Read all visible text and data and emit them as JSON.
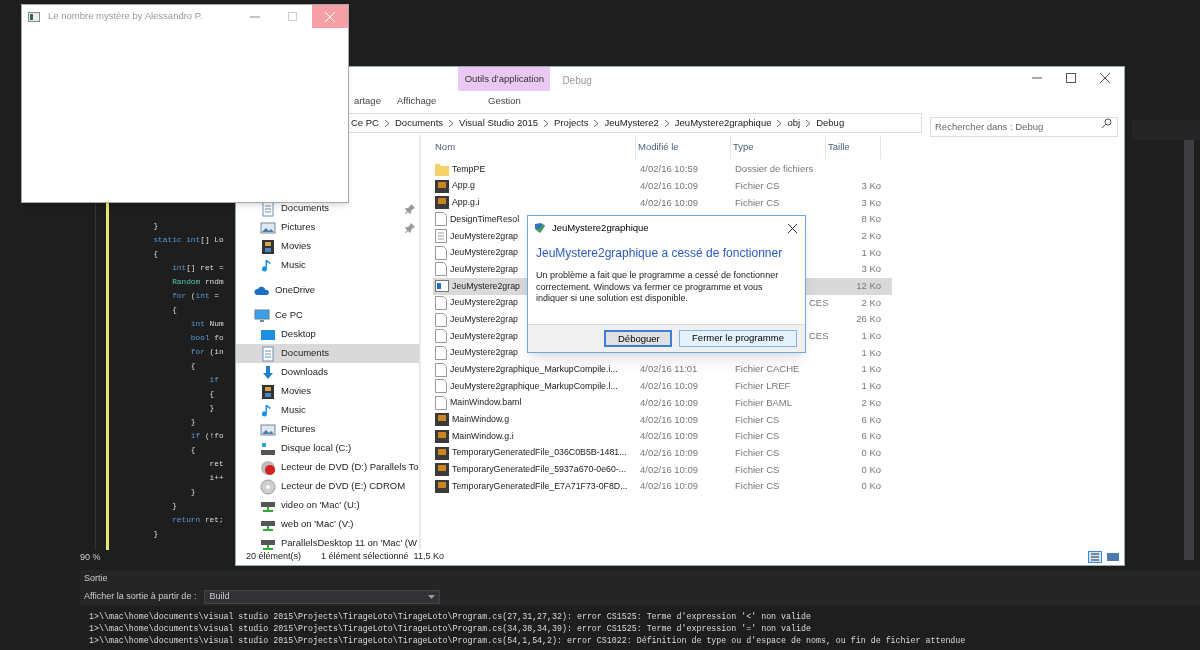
{
  "code_editor": {
    "zoom": "90 %",
    "lines": [
      {
        "tokens": [
          {
            "text": "        }",
            "kind": "plain"
          }
        ]
      },
      {
        "tokens": [
          {
            "text": "        static",
            "kind": "kw"
          },
          {
            "text": " int",
            "kind": "kw"
          },
          {
            "text": "[] Lo",
            "kind": "plain"
          }
        ]
      },
      {
        "tokens": [
          {
            "text": "        {",
            "kind": "plain"
          }
        ]
      },
      {
        "tokens": [
          {
            "text": "            int",
            "kind": "kw"
          },
          {
            "text": "[] ret =",
            "kind": "plain"
          }
        ]
      },
      {
        "tokens": [
          {
            "text": "            Random",
            "kind": "type"
          },
          {
            "text": " rndm",
            "kind": "plain"
          }
        ]
      },
      {
        "tokens": [
          {
            "text": "            for",
            "kind": "kw"
          },
          {
            "text": " (",
            "kind": "plain"
          },
          {
            "text": "int",
            "kind": "kw"
          },
          {
            "text": " =",
            "kind": "plain"
          }
        ]
      },
      {
        "tokens": [
          {
            "text": "            {",
            "kind": "plain"
          }
        ]
      },
      {
        "tokens": [
          {
            "text": "                int",
            "kind": "kw"
          },
          {
            "text": " Num",
            "kind": "plain"
          }
        ]
      },
      {
        "tokens": [
          {
            "text": "                bool",
            "kind": "kw"
          },
          {
            "text": " fo",
            "kind": "plain"
          }
        ]
      },
      {
        "tokens": [
          {
            "text": "                for",
            "kind": "kw"
          },
          {
            "text": " (in",
            "kind": "plain"
          }
        ]
      },
      {
        "tokens": [
          {
            "text": "                {",
            "kind": "plain"
          }
        ]
      },
      {
        "tokens": [
          {
            "text": "                    if",
            "kind": "kw"
          }
        ]
      },
      {
        "tokens": [
          {
            "text": "                    {",
            "kind": "plain"
          }
        ]
      },
      {
        "tokens": [
          {
            "text": "                    }",
            "kind": "plain"
          }
        ]
      },
      {
        "tokens": [
          {
            "text": "                }",
            "kind": "plain"
          }
        ]
      },
      {
        "tokens": [
          {
            "text": "                if",
            "kind": "kw"
          },
          {
            "text": " (!fo",
            "kind": "plain"
          }
        ]
      },
      {
        "tokens": [
          {
            "text": "                {",
            "kind": "plain"
          }
        ]
      },
      {
        "tokens": [
          {
            "text": "                    ret",
            "kind": "plain"
          }
        ]
      },
      {
        "tokens": [
          {
            "text": "                    i++",
            "kind": "plain"
          }
        ]
      },
      {
        "tokens": [
          {
            "text": "                }",
            "kind": "plain"
          }
        ]
      },
      {
        "tokens": [
          {
            "text": "            }",
            "kind": "plain"
          }
        ]
      },
      {
        "tokens": [
          {
            "text": "            return",
            "kind": "kw"
          },
          {
            "text": " ret;",
            "kind": "plain"
          }
        ]
      },
      {
        "tokens": [
          {
            "text": "        }",
            "kind": "plain"
          }
        ]
      }
    ]
  },
  "output_panel": {
    "title": "Sortie",
    "source_label": "Afficher la sortie à partir de :",
    "source": "Build",
    "lines": [
      "1>\\\\mac\\home\\documents\\visual studio 2015\\Projects\\TirageLoto\\TirageLoto\\Program.cs(27,31,27,32): error CS1525: Terme d'expression '<' non valide",
      "1>\\\\mac\\home\\documents\\visual studio 2015\\Projects\\TirageLoto\\TirageLoto\\Program.cs(34,38,34,39): error CS1525: Terme d'expression '=' non valide",
      "1>\\\\mac\\home\\documents\\visual studio 2015\\Projects\\TirageLoto\\TirageLoto\\Program.cs(54,1,54,2): error CS1022: Définition de type ou d'espace de noms, ou fin de fichier attendue"
    ]
  },
  "explorer": {
    "title": "Debug",
    "context_tab": "Outils d'application",
    "ribbon_tabs": [
      {
        "label": "artage",
        "selected": false
      },
      {
        "label": "Affichage",
        "selected": false
      },
      {
        "label": "Gestion",
        "selected": false
      }
    ],
    "breadcrumb": [
      "Ce PC",
      "Documents",
      "Visual Studio 2015",
      "Projects",
      "JeuMystere2",
      "JeuMystere2graphique",
      "obj",
      "Debug"
    ],
    "search": {
      "placeholder": "Rechercher dans : Debug"
    },
    "nav": [
      {
        "label": "Documents",
        "kind": "documents",
        "pinned": true,
        "selected": false
      },
      {
        "label": "Pictures",
        "kind": "pictures",
        "pinned": true,
        "selected": false
      },
      {
        "label": "Movies",
        "kind": "movies",
        "pinned": false,
        "selected": false
      },
      {
        "label": "Music",
        "kind": "music",
        "pinned": false,
        "selected": false
      },
      {
        "label": "OneDrive",
        "kind": "cloud",
        "pinned": false,
        "selected": false
      },
      {
        "label": "Ce PC",
        "kind": "pc",
        "pinned": false,
        "selected": false
      },
      {
        "label": "Desktop",
        "kind": "desktop",
        "pinned": false,
        "selected": false
      },
      {
        "label": "Documents",
        "kind": "documents",
        "pinned": false,
        "selected": true
      },
      {
        "label": "Downloads",
        "kind": "downloads",
        "pinned": false,
        "selected": false
      },
      {
        "label": "Movies",
        "kind": "movies",
        "pinned": false,
        "selected": false
      },
      {
        "label": "Music",
        "kind": "music",
        "pinned": false,
        "selected": false
      },
      {
        "label": "Pictures",
        "kind": "pictures",
        "pinned": false,
        "selected": false
      },
      {
        "label": "Disque local (C:)",
        "kind": "disk",
        "pinned": false,
        "selected": false
      },
      {
        "label": "Lecteur de DVD (D:) Parallels To",
        "kind": "dvdaudio",
        "pinned": false,
        "selected": false
      },
      {
        "label": "Lecteur de DVD (E:) CDROM",
        "kind": "dvd",
        "pinned": false,
        "selected": false
      },
      {
        "label": "video on 'Mac' (U:)",
        "kind": "network",
        "pinned": false,
        "selected": false
      },
      {
        "label": "web on 'Mac' (V:)",
        "kind": "network",
        "pinned": false,
        "selected": false
      },
      {
        "label": "ParallelsDesktop 11 on 'Mac' (W",
        "kind": "network",
        "pinned": false,
        "selected": false
      }
    ],
    "columns": [
      "Nom",
      "Modifié le",
      "Type",
      "Taille"
    ],
    "files": [
      {
        "name": "TempPE",
        "modified": "4/02/16 10:59",
        "type": "Dossier de fichiers",
        "kind": "folder",
        "selected": false
      },
      {
        "name": "App.g",
        "modified": "4/02/16 10:09",
        "type": "Fichier CS",
        "size": "3 Ko",
        "kind": "cs",
        "selected": false
      },
      {
        "name": "App.g.i",
        "modified": "4/02/16 10:09",
        "type": "Fichier CS",
        "size": "3 Ko",
        "kind": "cs",
        "selected": false
      },
      {
        "name": "DesignTimeResol",
        "size": "8 Ko",
        "kind": "blank",
        "selected": false
      },
      {
        "name": "JeuMystere2grap",
        "size": "2 Ko",
        "kind": "text",
        "selected": false
      },
      {
        "name": "JeuMystere2grap",
        "size": "1 Ko",
        "kind": "blank",
        "selected": false
      },
      {
        "name": "JeuMystere2grap",
        "size": "3 Ko",
        "kind": "blank",
        "selected": false
      },
      {
        "name": "JeuMystere2grap",
        "size": "12 Ko",
        "kind": "app",
        "selected": true
      },
      {
        "name": "JeuMystere2grap",
        "type": "CES",
        "size": "2 Ko",
        "kind": "blank",
        "selected": false
      },
      {
        "name": "JeuMystere2grap",
        "size": "26 Ko",
        "kind": "blank",
        "selected": false
      },
      {
        "name": "JeuMystere2grap",
        "type": "CES",
        "size": "1 Ko",
        "kind": "blank",
        "selected": false
      },
      {
        "name": "JeuMystere2grap",
        "size": "1 Ko",
        "kind": "blank",
        "selected": false
      },
      {
        "name": "JeuMystere2graphique_MarkupCompile.i...",
        "modified": "4/02/16 11:01",
        "type": "Fichier CACHE",
        "size": "1 Ko",
        "kind": "blank",
        "selected": false
      },
      {
        "name": "JeuMystere2graphique_MarkupCompile.l...",
        "modified": "4/02/16 10:09",
        "type": "Fichier LREF",
        "size": "1 Ko",
        "kind": "blank",
        "selected": false
      },
      {
        "name": "MainWindow.baml",
        "modified": "4/02/16 10:09",
        "type": "Fichier BAML",
        "size": "2 Ko",
        "kind": "blank",
        "selected": false
      },
      {
        "name": "MainWindow.g",
        "modified": "4/02/16 10:09",
        "type": "Fichier CS",
        "size": "6 Ko",
        "kind": "cs",
        "selected": false
      },
      {
        "name": "MainWindow.g.i",
        "modified": "4/02/16 10:09",
        "type": "Fichier CS",
        "size": "6 Ko",
        "kind": "cs",
        "selected": false
      },
      {
        "name": "TemporaryGeneratedFile_036C0B5B-1481...",
        "modified": "4/02/16 10:09",
        "type": "Fichier CS",
        "size": "0 Ko",
        "kind": "cs",
        "selected": false
      },
      {
        "name": "TemporaryGeneratedFile_5937a670-0e60-...",
        "modified": "4/02/16 10:09",
        "type": "Fichier CS",
        "size": "0 Ko",
        "kind": "cs",
        "selected": false
      },
      {
        "name": "TemporaryGeneratedFile_E7A71F73-0F8D...",
        "modified": "4/02/16 10:09",
        "type": "Fichier CS",
        "size": "0 Ko",
        "kind": "cs",
        "selected": false
      }
    ],
    "status": {
      "count": "20 élément(s)",
      "selection": "1 élément sélectionné  11,5 Ko"
    }
  },
  "app_window": {
    "title": "Le nombre mystère by Alessandro P."
  },
  "error_dialog": {
    "title": "JeuMystere2graphique",
    "heading": "JeuMystere2graphique a cessé de fonctionner",
    "message": "Un problème a fait que le programme a cessé de fonctionner correctement. Windows va fermer ce programme et vous indiquer si une solution est disponible.",
    "buttons": [
      {
        "label": "Déboguer",
        "selected": true
      },
      {
        "label": "Fermer le programme",
        "selected": false
      }
    ]
  }
}
